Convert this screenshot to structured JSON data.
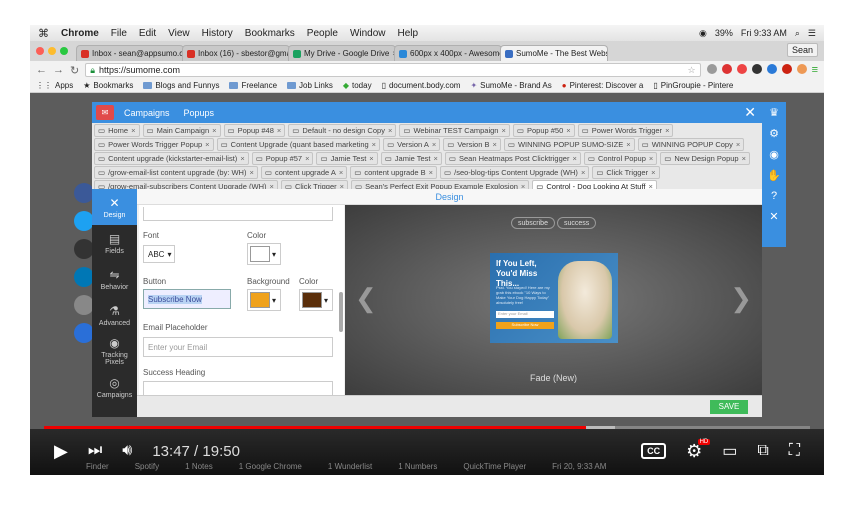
{
  "menubar": {
    "apple": "",
    "items": [
      "Chrome",
      "File",
      "Edit",
      "View",
      "History",
      "Bookmarks",
      "People",
      "Window",
      "Help"
    ],
    "battery": "39%",
    "clock": "Fri 9:33 AM"
  },
  "chrome_tabs": [
    {
      "label": "Inbox - sean@appsumo.co",
      "color": "#d93025"
    },
    {
      "label": "Inbox (16) - sbestor@gmail",
      "color": "#d93025"
    },
    {
      "label": "My Drive - Google Drive",
      "color": "#1aa260"
    },
    {
      "label": "600px x 400px - Awesome",
      "color": "#2a88d8"
    },
    {
      "label": "SumoMe - The Best Websi",
      "color": "#3a6ec2"
    }
  ],
  "profile": "Sean",
  "url": "https://sumome.com",
  "bookmarks": [
    "Apps",
    "Bookmarks",
    "Blogs and Funnys",
    "Freelance",
    "Job Links",
    "today",
    "document.body.com",
    "SumoMe - Brand As",
    "Pinterest: Discover a",
    "PinGroupie - Pintere"
  ],
  "sumome": {
    "nav": [
      "Campaigns",
      "Popups"
    ],
    "tab_rows": [
      [
        "Home",
        "Main Campaign",
        "Popup #48",
        "Default - no design Copy",
        "Webinar TEST Campaign",
        "Popup #50",
        "Power Words Trigger"
      ],
      [
        "Power Words Trigger Popup",
        "Content Upgrade (quant based marketing",
        "Version A",
        "Version B",
        "WINNING POPUP SUMO-SIZE",
        "WINNING POPUP Copy"
      ],
      [
        "Content upgrade (kickstarter-email-list)",
        "Popup #57",
        "Jamie Test",
        "Jamie Test",
        "Sean Heatmaps Post Clicktrigger",
        "Control Popup",
        "New Design Popup"
      ],
      [
        "/grow-email-list content upgrade (by: WH)",
        "content upgrade A",
        "content upgrade B",
        "/seo-blog-tips Content Upgrade (WH)",
        "Click Trigger"
      ],
      [
        "/grow-email-subscribers Content Upgrade (WH)",
        "Click Trigger",
        "Sean's Perfect Exit Popup Example Explosion",
        "Control - Dog Looking At Stuff"
      ]
    ],
    "left_nav": [
      {
        "label": "Design",
        "glyph": "✕"
      },
      {
        "label": "Fields",
        "glyph": "▤"
      },
      {
        "label": "Behavior",
        "glyph": "⇋"
      },
      {
        "label": "Advanced",
        "glyph": "⚗"
      },
      {
        "label": "Tracking Pixels",
        "glyph": "◉"
      },
      {
        "label": "Campaigns",
        "glyph": "◎"
      }
    ],
    "header": "Design",
    "form": {
      "font_label": "Font",
      "font_value": "ABC",
      "color_label": "Color",
      "button_label": "Button",
      "button_value": "Subscribe Now",
      "background_label": "Background",
      "color2_label": "Color",
      "email_placeholder_label": "Email Placeholder",
      "email_placeholder_value": "Enter your Email",
      "success_heading_label": "Success Heading"
    },
    "preview": {
      "pill_subscribe": "subscribe",
      "pill_success": "success",
      "card_heading": "If You Left, You'd Miss This...",
      "card_body": "Psst. You stayed! Here are my grab this ebook \"10 Ways to Make Your Dog Happy Today\" absolutely free!",
      "card_input": "Enter your Email",
      "card_button": "Subscribe Now",
      "caption": "Fade (New)"
    },
    "save": "SAVE"
  },
  "video": {
    "time_current": "13:47",
    "time_total": "19:50",
    "time_display": "13:47 / 19:50",
    "progress": 0.707,
    "buffered": 0.745,
    "hd_badge": "HD",
    "cc": "CC"
  },
  "dock": [
    "Finder",
    "Spotify",
    "1 Notes",
    "1 Google Chrome",
    "1 Wunderlist",
    "1 Numbers",
    "QuickTime Player",
    "Fri 20, 9:33 AM"
  ],
  "colors": {
    "accent": "#3a8fe0",
    "save": "#3fbb5a",
    "progress": "#e00000",
    "button_bg": "#f0a21b",
    "button_text_color": "#5a2e0a"
  }
}
